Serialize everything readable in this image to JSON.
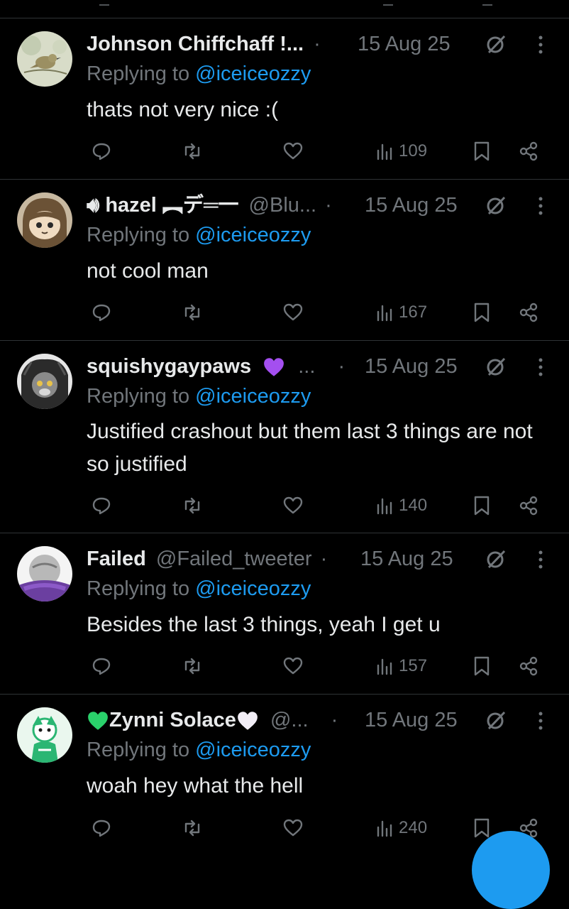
{
  "posts": [
    {
      "name": "Johnson Chiffchaff !...",
      "handle": "",
      "separator": "·",
      "date": "15 Aug 25",
      "replying_prefix": "Replying to ",
      "replying_to": "@iceiceozzy",
      "text": "thats not very nice :(",
      "views": "109"
    },
    {
      "name": "hazel ︻デ═一",
      "handle": "@Blu...",
      "separator": "·",
      "date": "15 Aug 25",
      "replying_prefix": "Replying to ",
      "replying_to": "@iceiceozzy",
      "text": "not cool man",
      "views": "167"
    },
    {
      "name": "squishygaypaws",
      "handle": "...",
      "separator": "·",
      "date": "15 Aug 25",
      "replying_prefix": "Replying to ",
      "replying_to": "@iceiceozzy",
      "text": "Justified crashout but them last 3 things are not so justified",
      "views": "140"
    },
    {
      "name": "Failed",
      "handle": "@Failed_tweeter",
      "separator": "·",
      "date": "15 Aug 25",
      "replying_prefix": "Replying to ",
      "replying_to": "@iceiceozzy",
      "text": "Besides the last 3 things, yeah I get u",
      "views": "157"
    },
    {
      "name": "Zynni Solace",
      "handle": "@...",
      "separator": "·",
      "date": "15 Aug 25",
      "replying_prefix": "Replying to ",
      "replying_to": "@iceiceozzy",
      "text": "woah hey what the hell",
      "views": "240"
    }
  ],
  "colors": {
    "background": "#000000",
    "text": "#e7e9ea",
    "muted": "#71767b",
    "link": "#1d9bf0",
    "divider": "#2f3336",
    "purple_heart": "#a44ff0",
    "green_heart": "#2ad16b"
  },
  "icons": {
    "reply": "reply-icon",
    "repost": "repost-icon",
    "like": "like-icon",
    "views": "views-icon",
    "bookmark": "bookmark-icon",
    "share": "share-icon",
    "grok": "grok-icon",
    "more": "more-icon"
  }
}
